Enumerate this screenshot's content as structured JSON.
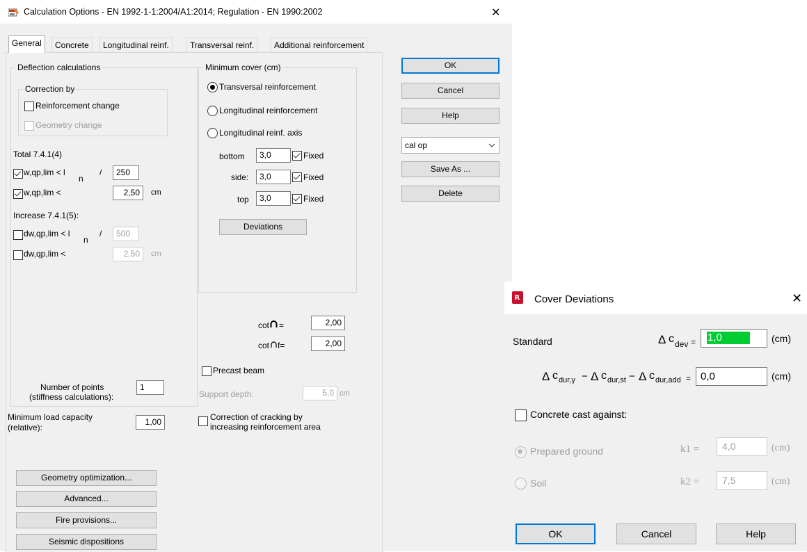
{
  "main": {
    "title": "Calculation Options - EN 1992-1-1:2004/A1:2014;  Regulation - EN 1990:2002",
    "tabs": [
      "General",
      "Concrete",
      "Longitudinal reinf.",
      "Transversal reinf.",
      "Additional reinforcement"
    ],
    "deflection": {
      "title": "Deflection calculations",
      "correction_title": "Correction by",
      "reinf_change": "Reinforcement change",
      "geom_change": "Geometry change",
      "total_label": "Total 7.4.1(4)",
      "w_ratio_label": "w,qp,lim < l",
      "w_ratio_sub": "n",
      "slash": "/",
      "w_ratio_value": "250",
      "w_abs_label": "w,qp,lim <",
      "w_abs_value": "2,50",
      "unit_cm": "cm",
      "increase_label": "Increase 7.4.1(5):",
      "dw_ratio_label": "dw,qp,lim < l",
      "dw_ratio_sub": "n",
      "dw_ratio_value": "500",
      "dw_abs_label": "dw,qp,lim <",
      "dw_abs_value": "2,50",
      "points_label_1": "Number of points",
      "points_label_2": "(stiffness calculations):",
      "points_value": "1"
    },
    "min_load": {
      "label_1": "Minimum load capacity",
      "label_2": "(relative):",
      "value": "1,00"
    },
    "cover": {
      "title": "Minimum cover (cm)",
      "radio_transversal": "Transversal reinforcement",
      "radio_longitudinal": "Longitudinal reinforcement",
      "radio_axis": "Longitudinal reinf. axis",
      "bottom_label": "bottom",
      "bottom_value": "3,0",
      "side_label": "side:",
      "side_value": "3,0",
      "top_label": "top",
      "top_value": "3,0",
      "fixed_label": "Fixed",
      "deviations_button": "Deviations"
    },
    "cot_label": "cot",
    "cot_eq": "=",
    "cot_value": "2,00",
    "cotf_label": "cot",
    "cotf_eq": "f=",
    "cotf_value": "2,00",
    "precast_label": "Precast beam",
    "support_depth_label": "Support depth:",
    "support_depth_value": "5,0",
    "support_depth_unit": "cm",
    "cracking_label_1": "Correction of cracking by",
    "cracking_label_2": "increasing reinforcement area",
    "bottom_buttons": [
      "Geometry optimization...",
      "Advanced...",
      "Fire provisions...",
      "Seismic dispositions"
    ],
    "side_buttons": {
      "ok": "OK",
      "cancel": "Cancel",
      "help": "Help",
      "save_as": "Save As ...",
      "delete": "Delete"
    },
    "preset_select": "cal op",
    "close_glyph": "✕"
  },
  "dialog": {
    "title": "Cover Deviations",
    "close_glyph": "✕",
    "standard_label": "Standard",
    "delta": "Δ",
    "c": "c",
    "dev_sub": "dev",
    "eq": "=",
    "dev_value": "1,0",
    "unit": "(cm)",
    "dur_gamma_sub": "dur,γ",
    "minus": "−",
    "dur_st_sub": "dur,st",
    "dur_add_sub": "dur,add",
    "dur_value": "0,0",
    "cast_label": "Concrete cast against:",
    "prepared_ground": "Prepared ground",
    "soil": "Soil",
    "k1_label": "k1 =",
    "k1_value": "4,0",
    "k2_label": "k2 =",
    "k2_value": "7,5",
    "ok": "OK",
    "cancel": "Cancel",
    "help": "Help"
  },
  "colors": {
    "accent": "#0078d7",
    "input_highlight": "#00cc33",
    "revit_icon": "#c8102e",
    "panel_bg": "#f0f0f0"
  }
}
